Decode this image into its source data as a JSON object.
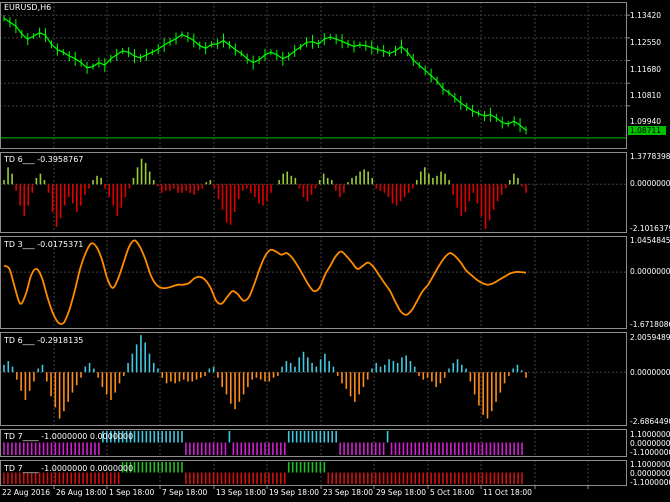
{
  "window": {
    "title": "EURUSD,H6",
    "background": "#000000",
    "grid_color": "#404040",
    "axis_color": "#8c8c8c",
    "text_color": "#ffffff"
  },
  "main_chart": {
    "symbol": "EURUSD",
    "timeframe": "H6",
    "type": "line",
    "color": "#00ff00",
    "current_price": "1.08711",
    "current_price_value": 1.08711,
    "price_line_color": "#00c000",
    "y_ticks": [
      "1.13420",
      "1.12550",
      "1.11680",
      "1.10810",
      "1.09940"
    ],
    "y_range": [
      1.084,
      1.1385
    ],
    "series": [
      1.133,
      1.1315,
      1.13,
      1.127,
      1.125,
      1.1262,
      1.1275,
      1.1265,
      1.123,
      1.121,
      1.12,
      1.1185,
      1.1175,
      1.116,
      1.114,
      1.1145,
      1.116,
      1.115,
      1.1175,
      1.119,
      1.1205,
      1.12,
      1.1185,
      1.1178,
      1.119,
      1.12,
      1.1212,
      1.1228,
      1.124,
      1.1252,
      1.1268,
      1.1258,
      1.1245,
      1.1225,
      1.1215,
      1.123,
      1.1232,
      1.1245,
      1.1228,
      1.121,
      1.1195,
      1.1175,
      1.116,
      1.117,
      1.119,
      1.12,
      1.119,
      1.1175,
      1.1185,
      1.1205,
      1.122,
      1.1238,
      1.124,
      1.1232,
      1.125,
      1.1258,
      1.125,
      1.1242,
      1.1232,
      1.1222,
      1.1228,
      1.1225,
      1.1218,
      1.121,
      1.1205,
      1.1195,
      1.1205,
      1.1222,
      1.12,
      1.117,
      1.115,
      1.113,
      1.111,
      1.109,
      1.106,
      1.1045,
      1.1025,
      1.1005,
      1.099,
      1.0975,
      1.0965,
      1.0955,
      1.096,
      1.0948,
      1.093,
      1.0925,
      1.0935,
      1.092,
      1.09
    ]
  },
  "indicators": [
    {
      "key": "td1",
      "label": "TD 6___ -0.3958767",
      "type": "histogram",
      "y_ticks": [
        "1.3778398",
        "0.0000000",
        "-2.1016379"
      ],
      "y_range": [
        -2.1016379,
        1.3778398
      ],
      "up_color": "#9acd32",
      "down_color": "#e00000",
      "values": [
        0.2,
        0.8,
        0.5,
        -0.3,
        -1.0,
        -1.5,
        -1.0,
        -0.4,
        0.3,
        0.5,
        0.2,
        -0.4,
        -1.3,
        -2.0,
        -1.6,
        -1.0,
        -0.6,
        -0.9,
        -1.3,
        -1.0,
        -0.5,
        -0.2,
        0.2,
        0.4,
        0.3,
        -0.2,
        -0.6,
        -1.0,
        -1.5,
        -1.1,
        -0.6,
        -0.2,
        0.3,
        0.8,
        1.2,
        1.0,
        0.6,
        0.2,
        -0.1,
        -0.4,
        -0.3,
        -0.3,
        -0.2,
        -0.4,
        -0.4,
        -0.3,
        -0.4,
        -0.5,
        -0.3,
        -0.2,
        0.1,
        0.2,
        -0.2,
        -0.7,
        -1.2,
        -1.8,
        -1.9,
        -1.3,
        -0.7,
        -0.3,
        -0.2,
        -0.4,
        -0.6,
        -0.9,
        -1.0,
        -0.8,
        -0.4,
        0.0,
        0.2,
        0.5,
        0.6,
        0.4,
        0.3,
        -0.2,
        -0.6,
        -0.8,
        -0.5,
        -0.2,
        0.2,
        0.5,
        0.3,
        0.2,
        -0.3,
        -0.6,
        -0.4,
        0.1,
        0.3,
        0.4,
        0.6,
        0.7,
        0.6,
        0.3,
        -0.2,
        -0.3,
        -0.4,
        -0.6,
        -0.9,
        -1.0,
        -0.8,
        -0.6,
        -0.4,
        -0.2,
        0.2,
        0.6,
        0.8,
        0.5,
        0.3,
        0.4,
        0.6,
        0.5,
        0.2,
        -0.5,
        -1.1,
        -1.5,
        -1.3,
        -0.8,
        -0.4,
        -0.9,
        -1.5,
        -2.1,
        -1.7,
        -1.2,
        -0.8,
        -0.5,
        -0.2,
        0.2,
        0.5,
        0.3,
        -0.1,
        -0.4
      ]
    },
    {
      "key": "td2",
      "label": "TD 3___ -0.0175371",
      "type": "line",
      "y_ticks": [
        "1.0454845",
        "0.0000000",
        "-1.6718086"
      ],
      "y_range": [
        -1.6718086,
        1.0454845
      ],
      "color": "#ff8c00",
      "values": [
        0.2,
        0.1,
        -0.5,
        -1.0,
        -0.7,
        -0.1,
        0.1,
        -0.2,
        -0.8,
        -1.3,
        -1.6,
        -1.6,
        -1.2,
        -0.6,
        0.1,
        0.6,
        0.9,
        0.8,
        0.4,
        -0.2,
        -0.5,
        -0.2,
        0.3,
        0.8,
        1.0,
        0.8,
        0.4,
        -0.1,
        -0.4,
        -0.5,
        -0.5,
        -0.45,
        -0.4,
        -0.4,
        -0.35,
        -0.2,
        -0.15,
        -0.25,
        -0.5,
        -0.9,
        -1.0,
        -0.8,
        -0.6,
        -0.7,
        -0.9,
        -0.8,
        -0.4,
        0.1,
        0.5,
        0.7,
        0.65,
        0.55,
        0.6,
        0.45,
        0.2,
        -0.1,
        -0.4,
        -0.6,
        -0.5,
        -0.1,
        0.2,
        0.5,
        0.65,
        0.5,
        0.3,
        0.1,
        0.2,
        0.3,
        0.15,
        -0.1,
        -0.35,
        -0.6,
        -0.95,
        -1.25,
        -1.35,
        -1.2,
        -0.9,
        -0.6,
        -0.4,
        -0.1,
        0.2,
        0.45,
        0.6,
        0.5,
        0.3,
        0.05,
        -0.1,
        -0.25,
        -0.35,
        -0.4,
        -0.35,
        -0.25,
        -0.15,
        -0.05,
        0.0,
        0.0,
        -0.02
      ]
    },
    {
      "key": "td3",
      "label": "TD 6___ -0.2918135",
      "type": "histogram",
      "y_ticks": [
        "2.0059489",
        "0.0000000",
        "-2.6864490"
      ],
      "y_range": [
        -2.686449,
        2.0059489
      ],
      "up_color": "#40c8e0",
      "down_color": "#ff8c1a",
      "values": [
        0.4,
        0.6,
        0.3,
        -0.4,
        -1.0,
        -1.5,
        -1.0,
        -0.5,
        0.2,
        0.4,
        -0.5,
        -1.3,
        -1.9,
        -2.5,
        -2.1,
        -1.6,
        -1.1,
        -0.7,
        -0.3,
        0.3,
        0.5,
        0.2,
        -0.3,
        -0.8,
        -1.2,
        -1.5,
        -1.1,
        -0.6,
        -0.2,
        0.5,
        1.0,
        1.5,
        2.0,
        1.6,
        1.0,
        0.5,
        0.2,
        -0.3,
        -0.6,
        -0.5,
        -0.6,
        -0.5,
        -0.4,
        -0.5,
        -0.5,
        -0.4,
        -0.3,
        -0.2,
        0.2,
        0.3,
        -0.3,
        -0.8,
        -1.2,
        -1.7,
        -2.0,
        -1.6,
        -1.2,
        -0.8,
        -0.4,
        -0.3,
        -0.4,
        -0.5,
        -0.5,
        -0.3,
        -0.2,
        0.3,
        0.6,
        0.5,
        0.3,
        0.8,
        1.1,
        0.8,
        0.5,
        0.3,
        0.7,
        1.0,
        0.6,
        0.3,
        -0.2,
        -0.6,
        -0.9,
        -1.3,
        -1.6,
        -1.2,
        -0.8,
        -0.4,
        0.2,
        0.5,
        0.3,
        0.4,
        0.7,
        0.6,
        0.5,
        0.8,
        0.9,
        0.6,
        0.3,
        -0.2,
        -0.4,
        -0.3,
        -0.5,
        -0.8,
        -0.6,
        -0.3,
        0.2,
        0.5,
        0.7,
        0.4,
        0.2,
        -0.5,
        -1.2,
        -1.8,
        -2.3,
        -2.5,
        -2.1,
        -1.6,
        -1.1,
        -0.6,
        -0.2,
        0.2,
        0.4,
        0.1,
        -0.3
      ]
    },
    {
      "key": "td4",
      "label": "TD 7____ -1.0000000 0.0000000",
      "type": "state",
      "y_ticks": [
        "1.1000000",
        "0.0000000",
        "-1.1000000"
      ],
      "up_color": "#40c8e0",
      "down_color": "#d020d0",
      "segments": [
        {
          "state": -1,
          "length": 25
        },
        {
          "state": 1,
          "length": 21
        },
        {
          "state": -1,
          "length": 11
        },
        {
          "state": 1,
          "length": 1
        },
        {
          "state": -1,
          "length": 14
        },
        {
          "state": 1,
          "length": 13
        },
        {
          "state": -1,
          "length": 12
        },
        {
          "state": 1,
          "length": 1
        },
        {
          "state": -1,
          "length": 34
        }
      ]
    },
    {
      "key": "td5",
      "label": "TD 7____ -1.0000000 0.0000000",
      "type": "state",
      "y_ticks": [
        "1.1000000",
        "0.0000000",
        "-1.1000000"
      ],
      "up_color": "#22c022",
      "down_color": "#d01010",
      "segments": [
        {
          "state": -1,
          "length": 30
        },
        {
          "state": 1,
          "length": 16
        },
        {
          "state": -1,
          "length": 26
        },
        {
          "state": 1,
          "length": 10
        },
        {
          "state": -1,
          "length": 50
        }
      ]
    }
  ],
  "x_axis": {
    "labels": [
      "22 Aug 2016",
      "26 Aug 18:00",
      "1 Sep 18:00",
      "7 Sep 18:00",
      "13 Sep 18:00",
      "19 Sep 18:00",
      "23 Sep 18:00",
      "29 Sep 18:00",
      "5 Oct 18:00",
      "11 Oct 18:00"
    ]
  }
}
